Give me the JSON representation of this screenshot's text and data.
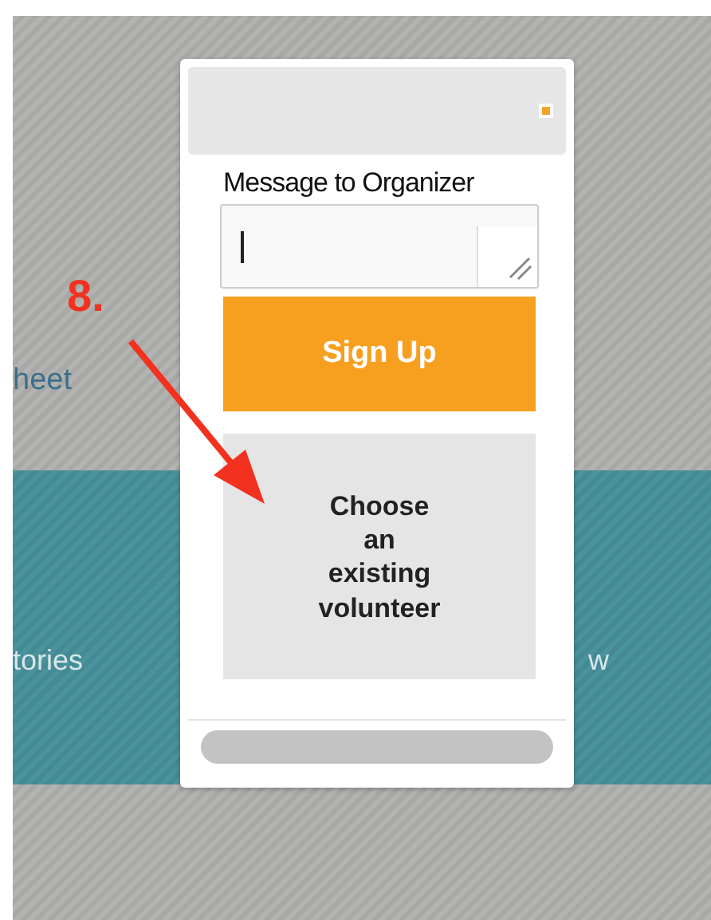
{
  "annotation": {
    "label": "8."
  },
  "background": {
    "top_link": "heet",
    "band_items": [
      {
        "text": "tories"
      },
      {
        "text": "w"
      }
    ]
  },
  "dialog": {
    "message_label": "Message to Organizer",
    "buttons": [
      {
        "label": "Sign Up",
        "kind": "primary"
      },
      {
        "label": "Choose an existing volunteer",
        "kind": "secondary"
      }
    ]
  }
}
